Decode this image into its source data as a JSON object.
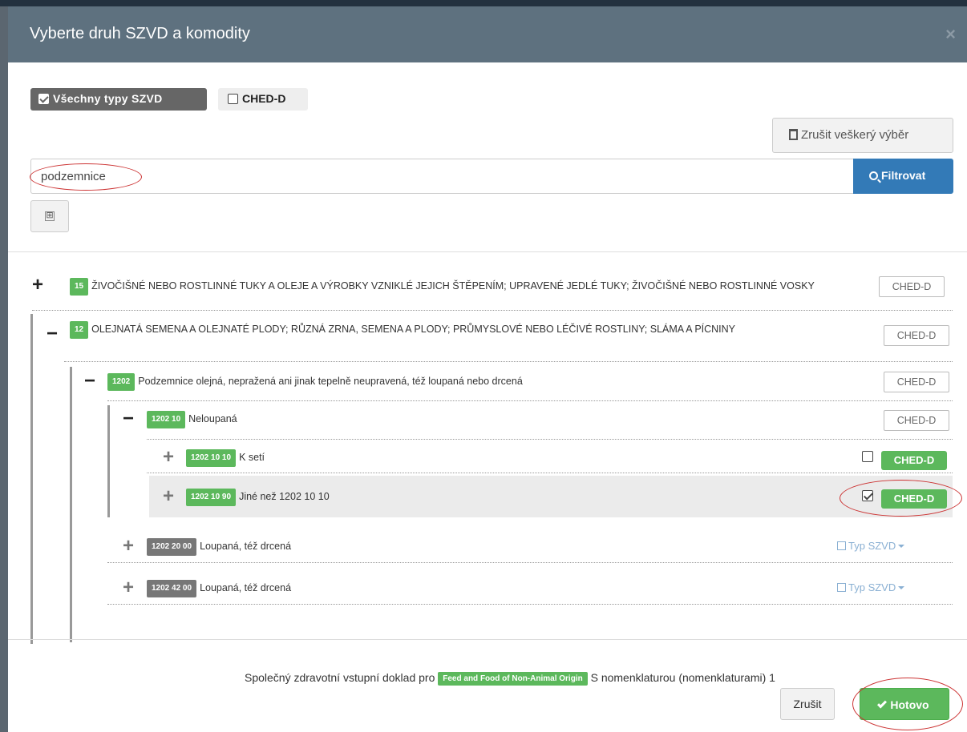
{
  "modal": {
    "title": "Vyberte druh SZVD a komodity",
    "close_glyph": "×"
  },
  "filters": {
    "all_types_label": "Všechny typy SZVD",
    "all_types_checked": true,
    "ched_d_label": "CHED-D",
    "ched_d_checked": false
  },
  "toolbar": {
    "clear_all_label": "Zrušit veškerý výběr",
    "clear_icon": "trash-icon"
  },
  "search": {
    "value": "podzemnice",
    "filter_button_label": "Filtrovat",
    "expand_all_glyph": "⊞"
  },
  "tree": [
    {
      "sign": "+",
      "code": "15",
      "text": "ŽIVOČIŠNÉ NEBO ROSTLINNÉ TUKY A OLEJE A VÝROBKY VZNIKLÉ JEJICH ŠTĚPENÍM; UPRAVENÉ JEDLÉ TUKY; ŽIVOČIŠNÉ NEBO ROSTLINNÉ VOSKY",
      "doc": "CHED-D"
    },
    {
      "sign": "−",
      "code": "12",
      "text": "OLEJNATÁ SEMENA A OLEJNATÉ PLODY; RŮZNÁ ZRNA, SEMENA A PLODY; PRŮMYSLOVÉ NEBO LÉČIVÉ ROSTLINY; SLÁMA A PÍCNINY",
      "doc": "CHED-D"
    },
    {
      "sign": "−",
      "code": "1202",
      "text": "Podzemnice olejná, nepražená ani jinak tepelně neupravená, též loupaná nebo drcená",
      "doc": "CHED-D"
    },
    {
      "sign": "−",
      "code": "1202 10",
      "text": "Neloupaná",
      "doc": "CHED-D"
    },
    {
      "sign": "+",
      "code": "1202 10 10",
      "text": "K setí",
      "doc": "CHED-D",
      "checked": false
    },
    {
      "sign": "+",
      "code": "1202 10 90",
      "text": "Jiné než 1202 10 10",
      "doc": "CHED-D",
      "checked": true
    },
    {
      "sign": "+",
      "code": "1202 20 00",
      "text": "Loupaná, též drcená",
      "doc_type": "Typ SZVD"
    },
    {
      "sign": "+",
      "code": "1202 42 00",
      "text": "Loupaná, též drcená",
      "doc_type": "Typ SZVD"
    }
  ],
  "footer": {
    "prefix": "Společný zdravotní vstupní doklad pro",
    "badge": "Feed and Food of Non-Animal Origin",
    "suffix": "S nomenklaturou (nomenklaturami) 1",
    "cancel_label": "Zrušit",
    "done_label": "Hotovo"
  },
  "colors": {
    "header_bg": "#5e717f",
    "primary": "#337ab7",
    "success": "#5cb85c",
    "annotation": "#cc3333"
  }
}
